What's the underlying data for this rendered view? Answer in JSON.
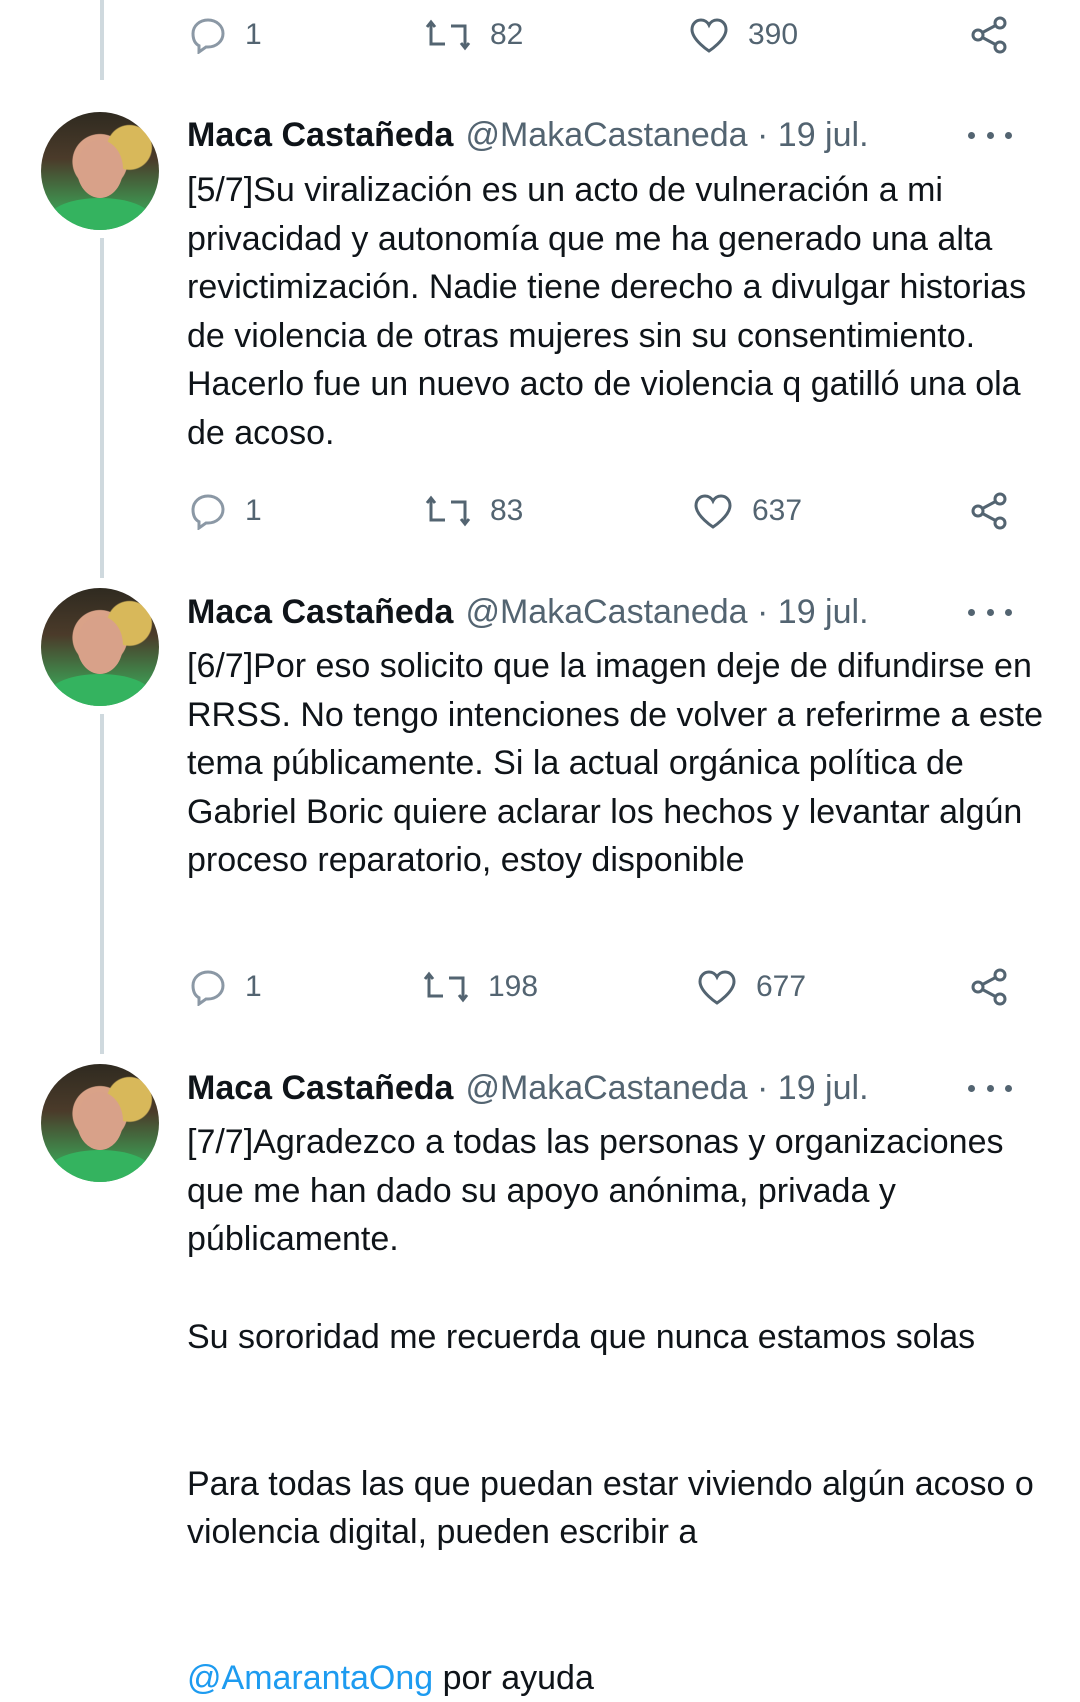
{
  "top_actions": {
    "reply_count": "1",
    "retweet_count": "82",
    "like_count": "390"
  },
  "tweets": [
    {
      "name": "Maca Castañeda",
      "handle_date": "@MakaCastaneda · 19 jul.",
      "text": "[5/7]Su viralización es un acto de vulneración a mi privacidad y autonomía que me ha generado una alta revictimización. Nadie tiene derecho a divulgar historias de violencia de otras mujeres sin su consentimiento. Hacerlo fue un nuevo acto de violencia q gatilló una ola de acoso.",
      "reply_count": "1",
      "retweet_count": "83",
      "like_count": "637"
    },
    {
      "name": "Maca Castañeda",
      "handle_date": "@MakaCastaneda · 19 jul.",
      "text": "[6/7]Por eso solicito que la imagen deje de difundirse en RRSS. No tengo intenciones de volver a referirme a este tema públicamente. Si la actual orgánica política de Gabriel Boric quiere aclarar los hechos y levantar algún proceso reparatorio, estoy disponible",
      "reply_count": "1",
      "retweet_count": "198",
      "like_count": "677"
    },
    {
      "name": "Maca Castañeda",
      "handle_date": "@MakaCastaneda · 19 jul.",
      "text_p1": "[7/7]Agradezco a todas las personas y organizaciones que me han dado su apoyo anónima, privada y públicamente.",
      "text_p2": "Su sororidad me recuerda que nunca estamos solas",
      "text_p3": "Para todas las que puedan estar viviendo algún acoso o violencia digital, pueden escribir a",
      "mention": "@AmarantaOng",
      "text_p3_end": " por ayuda"
    }
  ],
  "icons": {
    "reply": "reply-icon",
    "retweet": "retweet-icon",
    "like": "heart-icon",
    "share": "share-icon",
    "more": "more-icon"
  },
  "colors": {
    "text": "#0f1419",
    "secondary": "#536471",
    "mention": "#1d9bf0",
    "thread_line": "#cfd9de"
  }
}
